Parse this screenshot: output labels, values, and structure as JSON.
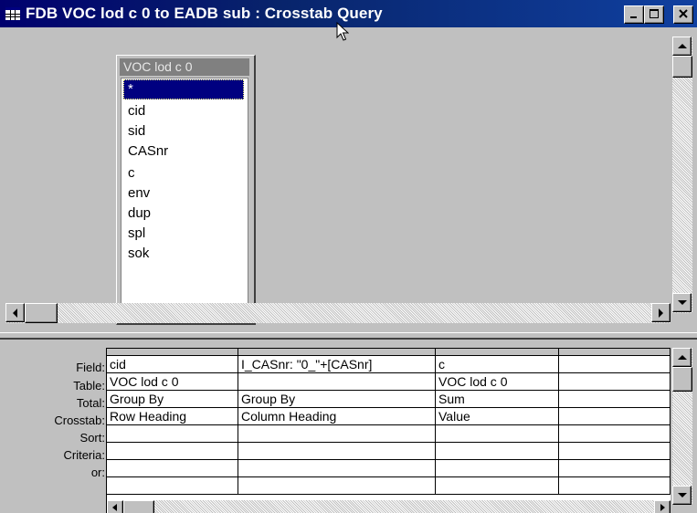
{
  "window": {
    "title": "FDB VOC lod c 0 to EADB sub : Crosstab Query",
    "minimize_label": "_",
    "maximize_label": "□",
    "close_label": "×"
  },
  "table_box": {
    "title": "VOC lod c 0",
    "fields": [
      "*",
      "cid",
      "sid",
      "CASnr",
      "c",
      "env",
      "dup",
      "spl",
      "sok"
    ],
    "selected_field": "*"
  },
  "grid": {
    "row_labels": [
      "Field:",
      "Table:",
      "Total:",
      "Crosstab:",
      "Sort:",
      "Criteria:",
      "or:"
    ],
    "columns": [
      {
        "field": "cid",
        "table": "VOC lod c 0",
        "total": "Group By",
        "crosstab": "Row Heading",
        "sort": "",
        "criteria": "",
        "or": ""
      },
      {
        "field": "I_CASnr: \"0_\"+[CASnr]",
        "table": "",
        "total": "Group By",
        "crosstab": "Column Heading",
        "sort": "",
        "criteria": "",
        "or": ""
      },
      {
        "field": "c",
        "table": "VOC lod c 0",
        "total": "Sum",
        "crosstab": "Value",
        "sort": "",
        "criteria": "",
        "or": ""
      },
      {
        "field": "",
        "table": "",
        "total": "",
        "crosstab": "",
        "sort": "",
        "criteria": "",
        "or": ""
      }
    ]
  },
  "colors": {
    "titlebar": "#00006e",
    "selection": "#000080",
    "face": "#c0c0c0"
  }
}
